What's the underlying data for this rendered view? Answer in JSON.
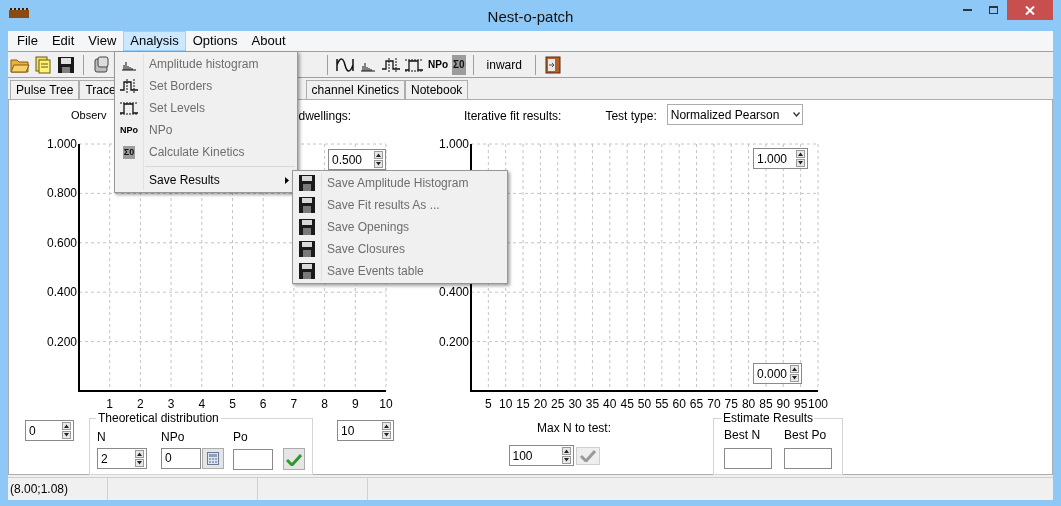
{
  "window": {
    "title": "Nest-o-patch"
  },
  "menu_bar": [
    {
      "label": "File",
      "selected": false
    },
    {
      "label": "Edit",
      "selected": false
    },
    {
      "label": "View",
      "selected": false
    },
    {
      "label": "Analysis",
      "selected": true
    },
    {
      "label": "Options",
      "selected": false
    },
    {
      "label": "About",
      "selected": false
    }
  ],
  "toolbar": {
    "npo_icon": "NPo",
    "sum_icon": "Σ0",
    "mode": "inward"
  },
  "tabs": [
    {
      "label": "Pulse Tree",
      "selected": false
    },
    {
      "label": "Trace",
      "selected": false
    },
    {
      "label": "channel Kinetics",
      "selected": false
    },
    {
      "label": "Notebook",
      "selected": false
    }
  ],
  "left_panel": {
    "heading_start": "Observ",
    "heading_end": "dwellings:",
    "chart_data": {
      "type": "bar",
      "grid": true,
      "xlim": [
        0,
        10
      ],
      "ylim": [
        0,
        1
      ],
      "xticks": [
        1,
        2,
        3,
        4,
        5,
        6,
        7,
        8,
        9,
        10
      ],
      "yticks": [
        {
          "value": 0.2,
          "label": "0.200"
        },
        {
          "value": 0.4,
          "label": "0.400"
        },
        {
          "value": 0.6,
          "label": "0.600"
        },
        {
          "value": 0.8,
          "label": "0.800"
        },
        {
          "value": 1,
          "label": "1.000"
        }
      ]
    },
    "max_spin": "0.500",
    "min_spin": "0",
    "xmax_spin": "10",
    "theoretical": {
      "title": "Theoretical distribution",
      "n_label": "N",
      "n_value": "2",
      "npo_label": "NPo",
      "npo_value": "0",
      "po_label": "Po"
    }
  },
  "right_panel": {
    "heading": "Iterative fit results:",
    "test_type_label": "Test type:",
    "test_type": "Normalized Pearson",
    "chart_data": {
      "type": "bar",
      "grid": true,
      "xlim": [
        0,
        100
      ],
      "ylim": [
        0,
        1
      ],
      "xticks": [
        5,
        10,
        15,
        20,
        25,
        30,
        35,
        40,
        45,
        50,
        55,
        60,
        65,
        70,
        75,
        80,
        85,
        90,
        95,
        100
      ],
      "yticks": [
        {
          "value": 0.2,
          "label": "0.200"
        },
        {
          "value": 0.4,
          "label": "0.400"
        },
        {
          "value": 1,
          "label": "1.000"
        }
      ]
    },
    "max_spin": "1.000",
    "min_spin": "0.000",
    "max_n_label": "Max N to test:",
    "max_n": "100",
    "apply_disabled": true,
    "estimate": {
      "title": "Estimate Results",
      "best_n_label": "Best N",
      "best_po_label": "Best Po"
    }
  },
  "status_bar": [
    "(8.00;1.08)"
  ],
  "analysis_menu": [
    {
      "label": "Amplitude histogram",
      "disabled": true
    },
    {
      "label": "Set Borders",
      "disabled": true
    },
    {
      "label": "Set Levels",
      "disabled": true
    },
    {
      "label": "NPo",
      "disabled": true,
      "icon_text": "NPo"
    },
    {
      "label": "Calculate Kinetics",
      "disabled": true,
      "icon_text": "Σ0"
    },
    {
      "label": "Save Results",
      "disabled": false,
      "expanded": true
    }
  ],
  "save_submenu": [
    {
      "label": "Save Amplitude Histogram",
      "disabled": true
    },
    {
      "label": "Save Fit results As ...",
      "disabled": true
    },
    {
      "label": "Save Openings",
      "disabled": true
    },
    {
      "label": "Save Closures",
      "disabled": true
    },
    {
      "label": "Save Events table",
      "disabled": true
    }
  ]
}
